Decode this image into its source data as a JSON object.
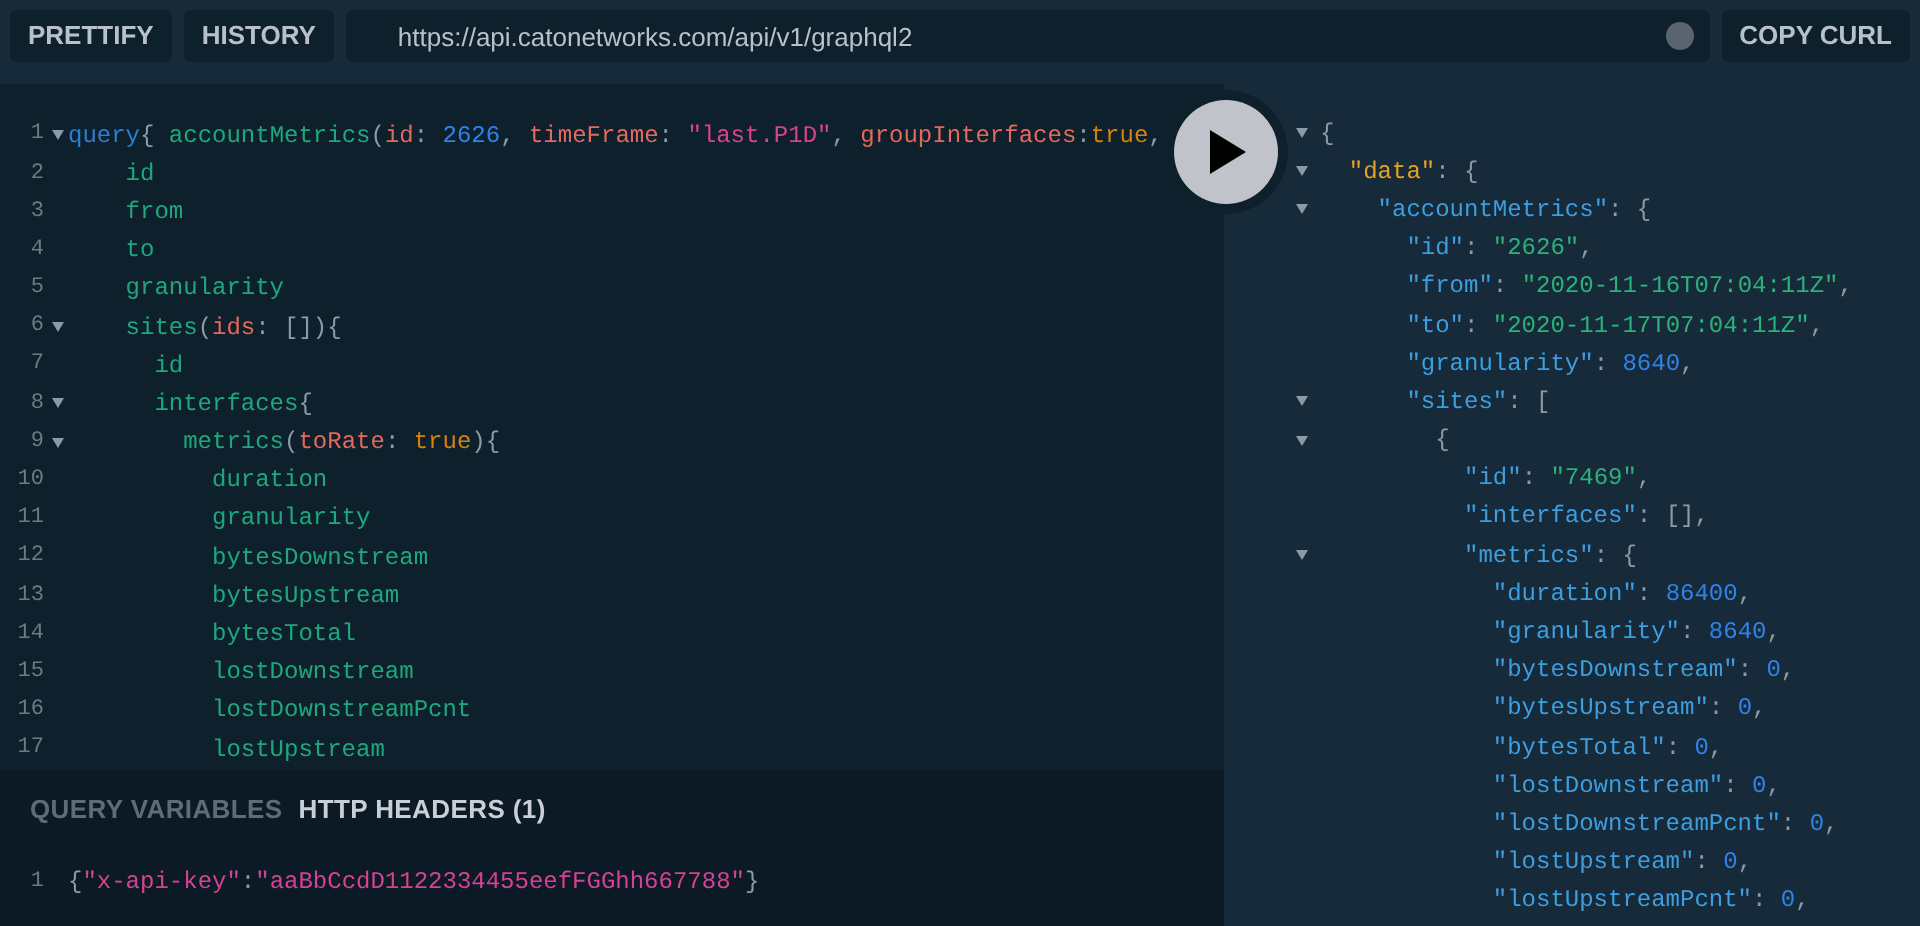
{
  "toolbar": {
    "buttons": [
      "PRETTIFY",
      "HISTORY"
    ],
    "url": "https://api.catonetworks.com/api/v1/graphql2",
    "copy_button": "COPY CURL"
  },
  "query_editor": {
    "lines": [
      {
        "number": "1",
        "foldable": true,
        "tokens": [
          {
            "kind": "keyword",
            "text": "query"
          },
          {
            "kind": "punct",
            "text": "{ "
          },
          {
            "kind": "field",
            "text": "accountMetrics"
          },
          {
            "kind": "punct",
            "text": "("
          },
          {
            "kind": "arg",
            "text": "id"
          },
          {
            "kind": "punct",
            "text": ": "
          },
          {
            "kind": "number",
            "text": "2626"
          },
          {
            "kind": "punct",
            "text": ", "
          },
          {
            "kind": "arg",
            "text": "timeFrame"
          },
          {
            "kind": "punct",
            "text": ": "
          },
          {
            "kind": "string",
            "text": "\"last.P1D\""
          },
          {
            "kind": "punct",
            "text": ", "
          },
          {
            "kind": "arg",
            "text": "groupInterfaces"
          },
          {
            "kind": "punct",
            "text": ":"
          },
          {
            "kind": "bool",
            "text": "true"
          },
          {
            "kind": "punct",
            "text": ","
          }
        ],
        "children": [
          {
            "number": "2",
            "foldable": false,
            "tokens": [
              {
                "kind": "field",
                "text": "id"
              }
            ]
          },
          {
            "number": "3",
            "foldable": false,
            "tokens": [
              {
                "kind": "field",
                "text": "from"
              }
            ]
          },
          {
            "number": "4",
            "foldable": false,
            "tokens": [
              {
                "kind": "field",
                "text": "to"
              }
            ]
          },
          {
            "number": "5",
            "foldable": false,
            "tokens": [
              {
                "kind": "field",
                "text": "granularity"
              }
            ]
          },
          {
            "number": "6",
            "foldable": true,
            "tokens": [
              {
                "kind": "field",
                "text": "sites"
              },
              {
                "kind": "punct",
                "text": "("
              },
              {
                "kind": "arg",
                "text": "ids"
              },
              {
                "kind": "punct",
                "text": ": []){"
              }
            ],
            "children": [
              {
                "number": "7",
                "foldable": false,
                "tokens": [
                  {
                    "kind": "field",
                    "text": "id"
                  }
                ]
              },
              {
                "number": "8",
                "foldable": true,
                "tokens": [
                  {
                    "kind": "field",
                    "text": "interfaces"
                  },
                  {
                    "kind": "punct",
                    "text": "{"
                  }
                ],
                "children": [
                  {
                    "number": "9",
                    "foldable": true,
                    "tokens": [
                      {
                        "kind": "field",
                        "text": "metrics"
                      },
                      {
                        "kind": "punct",
                        "text": "("
                      },
                      {
                        "kind": "arg",
                        "text": "toRate"
                      },
                      {
                        "kind": "punct",
                        "text": ": "
                      },
                      {
                        "kind": "bool",
                        "text": "true"
                      },
                      {
                        "kind": "punct",
                        "text": "){"
                      }
                    ],
                    "children": [
                      {
                        "number": "10",
                        "foldable": false,
                        "tokens": [
                          {
                            "kind": "field",
                            "text": "duration"
                          }
                        ]
                      },
                      {
                        "number": "11",
                        "foldable": false,
                        "tokens": [
                          {
                            "kind": "field",
                            "text": "granularity"
                          }
                        ]
                      },
                      {
                        "number": "12",
                        "foldable": false,
                        "tokens": [
                          {
                            "kind": "field",
                            "text": "bytesDownstream"
                          }
                        ]
                      },
                      {
                        "number": "13",
                        "foldable": false,
                        "tokens": [
                          {
                            "kind": "field",
                            "text": "bytesUpstream"
                          }
                        ]
                      },
                      {
                        "number": "14",
                        "foldable": false,
                        "tokens": [
                          {
                            "kind": "field",
                            "text": "bytesTotal"
                          }
                        ]
                      },
                      {
                        "number": "15",
                        "foldable": false,
                        "tokens": [
                          {
                            "kind": "field",
                            "text": "lostDownstream"
                          }
                        ]
                      },
                      {
                        "number": "16",
                        "foldable": false,
                        "tokens": [
                          {
                            "kind": "field",
                            "text": "lostDownstreamPcnt"
                          }
                        ]
                      },
                      {
                        "number": "17",
                        "foldable": false,
                        "tokens": [
                          {
                            "kind": "field",
                            "text": "lostUpstream"
                          }
                        ]
                      }
                    ]
                  }
                ]
              }
            ]
          }
        ]
      }
    ]
  },
  "bottom_panel": {
    "tabs": [
      {
        "label": "QUERY VARIABLES",
        "selected": false
      },
      {
        "label": "HTTP HEADERS (1)",
        "selected": true
      }
    ],
    "lines": [
      {
        "number": "1",
        "tokens": [
          {
            "kind": "punct",
            "text": "{"
          },
          {
            "kind": "string",
            "text": "\"x-api-key\""
          },
          {
            "kind": "punct",
            "text": ":"
          },
          {
            "kind": "string",
            "text": "\"aaBbCcdD1122334455eefFGGhh667788\""
          },
          {
            "kind": "punct",
            "text": "}"
          }
        ]
      }
    ]
  },
  "result": {
    "lines": [
      {
        "foldable": true,
        "tokens": [
          {
            "kind": "punct",
            "text": "{"
          }
        ],
        "children": [
          {
            "foldable": true,
            "tokens": [
              {
                "kind": "root_key",
                "text": "\"data\""
              },
              {
                "kind": "punct",
                "text": ": {"
              }
            ],
            "children": [
              {
                "foldable": true,
                "tokens": [
                  {
                    "kind": "key",
                    "text": "\"accountMetrics\""
                  },
                  {
                    "kind": "punct",
                    "text": ": {"
                  }
                ],
                "children": [
                  {
                    "foldable": false,
                    "tokens": [
                      {
                        "kind": "key",
                        "text": "\"id\""
                      },
                      {
                        "kind": "punct",
                        "text": ": "
                      },
                      {
                        "kind": "string",
                        "text": "\"2626\""
                      },
                      {
                        "kind": "punct",
                        "text": ","
                      }
                    ]
                  },
                  {
                    "foldable": false,
                    "tokens": [
                      {
                        "kind": "key",
                        "text": "\"from\""
                      },
                      {
                        "kind": "punct",
                        "text": ": "
                      },
                      {
                        "kind": "string",
                        "text": "\"2020-11-16T07:04:11Z\""
                      },
                      {
                        "kind": "punct",
                        "text": ","
                      }
                    ]
                  },
                  {
                    "foldable": false,
                    "tokens": [
                      {
                        "kind": "key",
                        "text": "\"to\""
                      },
                      {
                        "kind": "punct",
                        "text": ": "
                      },
                      {
                        "kind": "string",
                        "text": "\"2020-11-17T07:04:11Z\""
                      },
                      {
                        "kind": "punct",
                        "text": ","
                      }
                    ]
                  },
                  {
                    "foldable": false,
                    "tokens": [
                      {
                        "kind": "key",
                        "text": "\"granularity\""
                      },
                      {
                        "kind": "punct",
                        "text": ": "
                      },
                      {
                        "kind": "number",
                        "text": "8640"
                      },
                      {
                        "kind": "punct",
                        "text": ","
                      }
                    ]
                  },
                  {
                    "foldable": true,
                    "tokens": [
                      {
                        "kind": "key",
                        "text": "\"sites\""
                      },
                      {
                        "kind": "punct",
                        "text": ": ["
                      }
                    ],
                    "children": [
                      {
                        "foldable": true,
                        "tokens": [
                          {
                            "kind": "punct",
                            "text": "{"
                          }
                        ],
                        "children": [
                          {
                            "foldable": false,
                            "tokens": [
                              {
                                "kind": "key",
                                "text": "\"id\""
                              },
                              {
                                "kind": "punct",
                                "text": ": "
                              },
                              {
                                "kind": "string",
                                "text": "\"7469\""
                              },
                              {
                                "kind": "punct",
                                "text": ","
                              }
                            ]
                          },
                          {
                            "foldable": false,
                            "tokens": [
                              {
                                "kind": "key",
                                "text": "\"interfaces\""
                              },
                              {
                                "kind": "punct",
                                "text": ": [],"
                              }
                            ]
                          },
                          {
                            "foldable": true,
                            "tokens": [
                              {
                                "kind": "key",
                                "text": "\"metrics\""
                              },
                              {
                                "kind": "punct",
                                "text": ": {"
                              }
                            ],
                            "children": [
                              {
                                "foldable": false,
                                "tokens": [
                                  {
                                    "kind": "key",
                                    "text": "\"duration\""
                                  },
                                  {
                                    "kind": "punct",
                                    "text": ": "
                                  },
                                  {
                                    "kind": "number",
                                    "text": "86400"
                                  },
                                  {
                                    "kind": "punct",
                                    "text": ","
                                  }
                                ]
                              },
                              {
                                "foldable": false,
                                "tokens": [
                                  {
                                    "kind": "key",
                                    "text": "\"granularity\""
                                  },
                                  {
                                    "kind": "punct",
                                    "text": ": "
                                  },
                                  {
                                    "kind": "number",
                                    "text": "8640"
                                  },
                                  {
                                    "kind": "punct",
                                    "text": ","
                                  }
                                ]
                              },
                              {
                                "foldable": false,
                                "tokens": [
                                  {
                                    "kind": "key",
                                    "text": "\"bytesDownstream\""
                                  },
                                  {
                                    "kind": "punct",
                                    "text": ": "
                                  },
                                  {
                                    "kind": "number",
                                    "text": "0"
                                  },
                                  {
                                    "kind": "punct",
                                    "text": ","
                                  }
                                ]
                              },
                              {
                                "foldable": false,
                                "tokens": [
                                  {
                                    "kind": "key",
                                    "text": "\"bytesUpstream\""
                                  },
                                  {
                                    "kind": "punct",
                                    "text": ": "
                                  },
                                  {
                                    "kind": "number",
                                    "text": "0"
                                  },
                                  {
                                    "kind": "punct",
                                    "text": ","
                                  }
                                ]
                              },
                              {
                                "foldable": false,
                                "tokens": [
                                  {
                                    "kind": "key",
                                    "text": "\"bytesTotal\""
                                  },
                                  {
                                    "kind": "punct",
                                    "text": ": "
                                  },
                                  {
                                    "kind": "number",
                                    "text": "0"
                                  },
                                  {
                                    "kind": "punct",
                                    "text": ","
                                  }
                                ]
                              },
                              {
                                "foldable": false,
                                "tokens": [
                                  {
                                    "kind": "key",
                                    "text": "\"lostDownstream\""
                                  },
                                  {
                                    "kind": "punct",
                                    "text": ": "
                                  },
                                  {
                                    "kind": "number",
                                    "text": "0"
                                  },
                                  {
                                    "kind": "punct",
                                    "text": ","
                                  }
                                ]
                              },
                              {
                                "foldable": false,
                                "tokens": [
                                  {
                                    "kind": "key",
                                    "text": "\"lostDownstreamPcnt\""
                                  },
                                  {
                                    "kind": "punct",
                                    "text": ": "
                                  },
                                  {
                                    "kind": "number",
                                    "text": "0"
                                  },
                                  {
                                    "kind": "punct",
                                    "text": ","
                                  }
                                ]
                              },
                              {
                                "foldable": false,
                                "tokens": [
                                  {
                                    "kind": "key",
                                    "text": "\"lostUpstream\""
                                  },
                                  {
                                    "kind": "punct",
                                    "text": ": "
                                  },
                                  {
                                    "kind": "number",
                                    "text": "0"
                                  },
                                  {
                                    "kind": "punct",
                                    "text": ","
                                  }
                                ]
                              },
                              {
                                "foldable": false,
                                "tokens": [
                                  {
                                    "kind": "key",
                                    "text": "\"lostUpstreamPcnt\""
                                  },
                                  {
                                    "kind": "punct",
                                    "text": ": "
                                  },
                                  {
                                    "kind": "number",
                                    "text": "0"
                                  },
                                  {
                                    "kind": "punct",
                                    "text": ","
                                  }
                                ]
                              }
                            ]
                          }
                        ]
                      }
                    ]
                  }
                ]
              }
            ]
          }
        ]
      }
    ]
  }
}
